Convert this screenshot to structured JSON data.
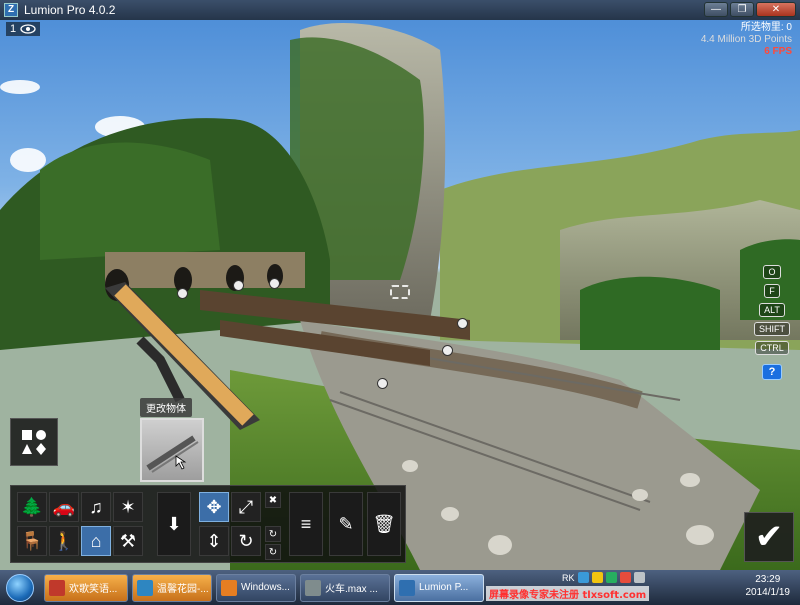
{
  "window": {
    "title": "Lumion Pro 4.0.2",
    "app_icon_glyph": "Z",
    "buttons": {
      "minimize": "—",
      "restore": "❐",
      "close": "✕"
    }
  },
  "hud": {
    "layer_number": "1",
    "selection_count": "所选物里: 0",
    "points": "4.4 Million 3D Points",
    "fps": "6 FPS"
  },
  "keys": [
    "O",
    "F",
    "ALT",
    "SHIFT",
    "CTRL"
  ],
  "help_key": "?",
  "tooltip": "更改物体",
  "toolbar": {
    "categories": [
      {
        "name": "tree-icon",
        "glyph": "🌲"
      },
      {
        "name": "car-icon",
        "glyph": "🚗"
      },
      {
        "name": "music-icon",
        "glyph": "♫"
      },
      {
        "name": "effects-icon",
        "glyph": "✶"
      },
      {
        "name": "chair-icon",
        "glyph": "🪑"
      },
      {
        "name": "person-icon",
        "glyph": "🚶"
      },
      {
        "name": "house-icon",
        "glyph": "⌂"
      },
      {
        "name": "tools-icon",
        "glyph": "⚒"
      }
    ],
    "place_glyph": "⬇",
    "move_glyph": "✥",
    "scale_glyph": "⤢",
    "height_glyph": "⇕",
    "rotate_glyph": "↻",
    "delete_x": "✖",
    "list_glyph": "≡",
    "edit_glyph": "✎",
    "trash_glyph": "🗑"
  },
  "confirm_glyph": "✔",
  "taskbar": {
    "tasks": [
      {
        "label": "欢歌笑语...",
        "style": "orange",
        "color": "#c0392b"
      },
      {
        "label": "温馨花园-...",
        "style": "orange",
        "color": "#2e86c1"
      },
      {
        "label": "Windows...",
        "style": "normal",
        "color": "#e67e22"
      },
      {
        "label": "火车.max ...",
        "style": "normal",
        "color": "#7f8c8d"
      },
      {
        "label": "Lumion P...",
        "style": "active",
        "color": "#2f6fb0"
      }
    ],
    "tray_text": "RK",
    "time": "23:29",
    "date": "2014/1/19",
    "watermark": "屏幕录像专家未注册 tlxsoft.com"
  }
}
